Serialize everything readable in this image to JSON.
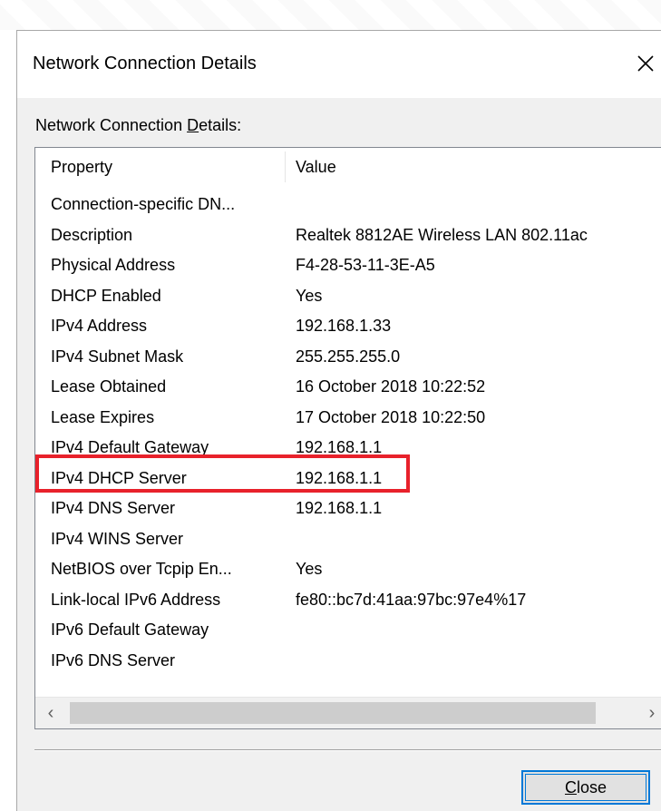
{
  "window": {
    "title": "Network Connection Details",
    "close_glyph": "✕"
  },
  "group": {
    "label_prefix": "Network Connection ",
    "label_accel": "D",
    "label_suffix": "etails:"
  },
  "columns": {
    "property": "Property",
    "value": "Value"
  },
  "rows": [
    {
      "property": "Connection-specific DN...",
      "value": ""
    },
    {
      "property": "Description",
      "value": "Realtek 8812AE Wireless LAN 802.11ac"
    },
    {
      "property": "Physical Address",
      "value": "F4-28-53-11-3E-A5"
    },
    {
      "property": "DHCP Enabled",
      "value": "Yes"
    },
    {
      "property": "IPv4 Address",
      "value": "192.168.1.33"
    },
    {
      "property": "IPv4 Subnet Mask",
      "value": "255.255.255.0"
    },
    {
      "property": "Lease Obtained",
      "value": "16 October 2018 10:22:52"
    },
    {
      "property": "Lease Expires",
      "value": "17 October 2018 10:22:50"
    },
    {
      "property": "IPv4 Default Gateway",
      "value": "192.168.1.1"
    },
    {
      "property": "IPv4 DHCP Server",
      "value": "192.168.1.1"
    },
    {
      "property": "IPv4 DNS Server",
      "value": "192.168.1.1"
    },
    {
      "property": "IPv4 WINS Server",
      "value": ""
    },
    {
      "property": "NetBIOS over Tcpip En...",
      "value": "Yes"
    },
    {
      "property": "Link-local IPv6 Address",
      "value": "fe80::bc7d:41aa:97bc:97e4%17"
    },
    {
      "property": "IPv6 Default Gateway",
      "value": ""
    },
    {
      "property": "IPv6 DNS Server",
      "value": ""
    }
  ],
  "scrollbar": {
    "left_glyph": "‹",
    "right_glyph": "›"
  },
  "buttons": {
    "close_accel": "C",
    "close_rest": "lose"
  },
  "colors": {
    "highlight": "#e8212b",
    "focus_border": "#0078d7"
  }
}
